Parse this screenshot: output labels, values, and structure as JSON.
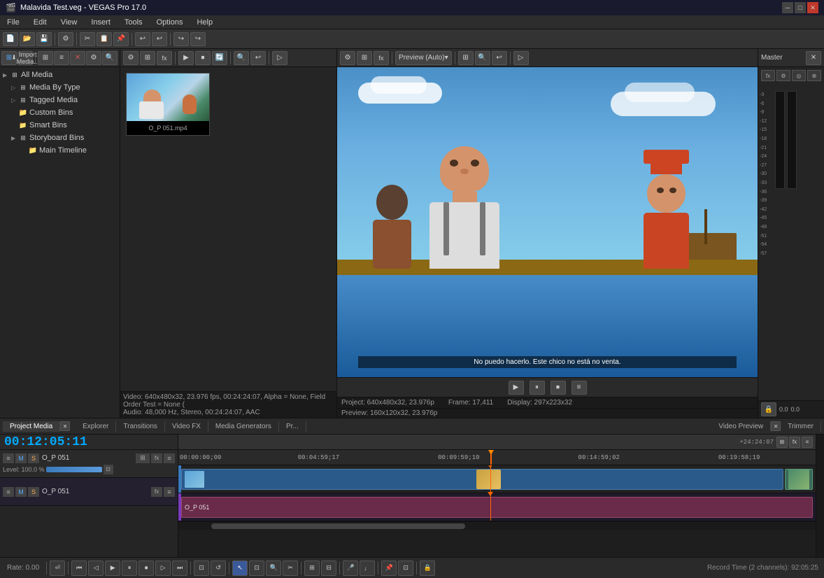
{
  "titlebar": {
    "title": "Malavida Test.veg - VEGAS Pro 17.0",
    "app_icon": "vegas-icon",
    "minimize_label": "─",
    "maximize_label": "□",
    "close_label": "✕"
  },
  "menubar": {
    "items": [
      "File",
      "Edit",
      "View",
      "Insert",
      "Tools",
      "Options",
      "Help"
    ]
  },
  "toolbar": {
    "buttons": [
      "new",
      "open",
      "save",
      "settings",
      "cut",
      "copy",
      "paste",
      "undo",
      "redo",
      "render"
    ]
  },
  "media_panel": {
    "import_button": "Import Media...",
    "tree": {
      "items": [
        {
          "label": "All Media",
          "level": 0,
          "icon": "folder",
          "expanded": true,
          "selected": false
        },
        {
          "label": "Media By Type",
          "level": 1,
          "icon": "folder",
          "expanded": false,
          "selected": false
        },
        {
          "label": "Tagged Media",
          "level": 1,
          "icon": "folder",
          "expanded": false,
          "selected": false
        },
        {
          "label": "Custom Bins",
          "level": 1,
          "icon": "folder-yellow",
          "expanded": false,
          "selected": false
        },
        {
          "label": "Smart Bins",
          "level": 1,
          "icon": "folder",
          "expanded": false,
          "selected": false
        },
        {
          "label": "Storyboard Bins",
          "level": 1,
          "icon": "folder",
          "expanded": true,
          "selected": false
        },
        {
          "label": "Main Timeline",
          "level": 2,
          "icon": "folder-yellow",
          "expanded": false,
          "selected": false
        }
      ]
    }
  },
  "media_file": {
    "name": "O_P_051.mp4",
    "thumbnail_label": "O_P 051.mp4"
  },
  "media_status": {
    "video": "Video: 640x480x32, 23.976 fps, 00:24:24:07, Alpha = None, Field Order Test = None (",
    "audio": "Audio: 48,000 Hz, Stereo, 00:24:24:07, AAC"
  },
  "preview": {
    "mode": "Preview (Auto)",
    "subtitle": "No puedo hacerlo. Este chico no está no venta.",
    "play_btn": "▶",
    "pause_btn": "⏸",
    "stop_btn": "⏹",
    "more_btn": "≡"
  },
  "preview_status": {
    "project": "Project: 640x480x32, 23.976p",
    "frame": "Frame:  17,411",
    "display": "Display: 297x223x32",
    "preview_res": "Preview: 160x120x32, 23.976p"
  },
  "master_bus": {
    "label": "Master",
    "scale_values": [
      "-3",
      "-6",
      "-9",
      "-12",
      "-15",
      "-18",
      "-21",
      "-24",
      "-27",
      "-30",
      "-33",
      "-36",
      "-39",
      "-42",
      "-45",
      "-48",
      "-51",
      "-54",
      "-57"
    ],
    "left_level": 0.0,
    "right_level": 0.0
  },
  "bottom_tabs": {
    "tabs": [
      "Project Media",
      "Explorer",
      "Transitions",
      "Video FX",
      "Media Generators",
      "Pr...",
      "Video Preview",
      "Trimmer"
    ],
    "active": "Project Media"
  },
  "timeline": {
    "timecode": "00:12:05:11",
    "end_time": "+24:24:07",
    "ticks": [
      {
        "time": "00:00:00;00",
        "pos": 0
      },
      {
        "time": "00:04:59;17",
        "pos": 22
      },
      {
        "time": "00:09:59;10",
        "pos": 44
      },
      {
        "time": "00:14:59;02",
        "pos": 66
      },
      {
        "time": "00:19:58;19",
        "pos": 88
      }
    ],
    "video_track": {
      "name": "O_P 051",
      "level": "Level: 100.0 %"
    },
    "audio_track": {
      "name": "O_P 051"
    }
  },
  "bottom_controls": {
    "rate": "Rate: 0.00",
    "record_time": "Record Time (2 channels): 92:05:25",
    "buttons": [
      "loop",
      "rewind",
      "step-back",
      "play",
      "pause",
      "stop",
      "step-forward",
      "fast-forward"
    ]
  }
}
